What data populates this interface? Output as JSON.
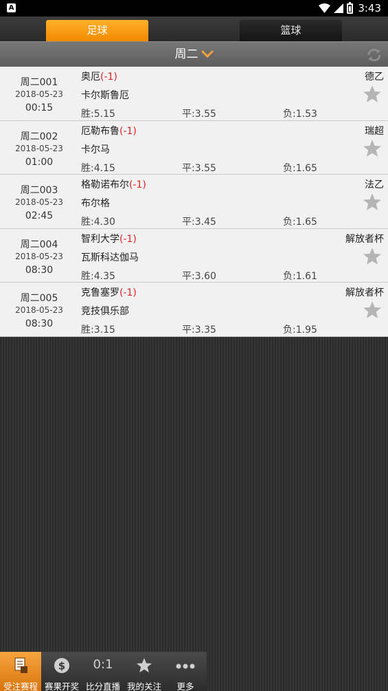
{
  "status_bar": {
    "app_icon_letter": "A",
    "time": "3:43"
  },
  "sport_tabs": [
    {
      "label": "足球",
      "active": true
    },
    {
      "label": "篮球",
      "active": false
    }
  ],
  "day_header": {
    "title": "周二"
  },
  "matches": [
    {
      "id": "周二001",
      "date": "2018-05-23",
      "time": "00:15",
      "home": "奥厄",
      "handicap": "(-1)",
      "away": "卡尔斯鲁厄",
      "league": "德乙",
      "win": "胜:5.15",
      "draw": "平:3.55",
      "lose": "负:1.53"
    },
    {
      "id": "周二002",
      "date": "2018-05-23",
      "time": "01:00",
      "home": "厄勒布鲁",
      "handicap": "(-1)",
      "away": "卡尔马",
      "league": "瑞超",
      "win": "胜:4.15",
      "draw": "平:3.55",
      "lose": "负:1.65"
    },
    {
      "id": "周二003",
      "date": "2018-05-23",
      "time": "02:45",
      "home": "格勒诺布尔",
      "handicap": "(-1)",
      "away": "布尔格",
      "league": "法乙",
      "win": "胜:4.30",
      "draw": "平:3.45",
      "lose": "负:1.65"
    },
    {
      "id": "周二004",
      "date": "2018-05-23",
      "time": "08:30",
      "home": "智利大学",
      "handicap": "(-1)",
      "away": "瓦斯科达伽马",
      "league": "解放者杯",
      "win": "胜:4.35",
      "draw": "平:3.60",
      "lose": "负:1.61"
    },
    {
      "id": "周二005",
      "date": "2018-05-23",
      "time": "08:30",
      "home": "克鲁塞罗",
      "handicap": "(-1)",
      "away": "竞技俱乐部",
      "league": "解放者杯",
      "win": "胜:3.15",
      "draw": "平:3.35",
      "lose": "负:1.95"
    }
  ],
  "bottom_nav": [
    {
      "label": "受注赛程",
      "icon": "betting-slip-icon",
      "active": true
    },
    {
      "label": "赛果开奖",
      "icon": "dollar-coin-icon",
      "active": false
    },
    {
      "label": "比分直播",
      "icon": "score-icon",
      "glyph": "0:1",
      "active": false
    },
    {
      "label": "我的关注",
      "icon": "star-icon",
      "active": false
    },
    {
      "label": "更多",
      "icon": "more-dots-icon",
      "active": false
    }
  ],
  "colors": {
    "accent": "#f28a00",
    "handicap": "#e02020"
  }
}
